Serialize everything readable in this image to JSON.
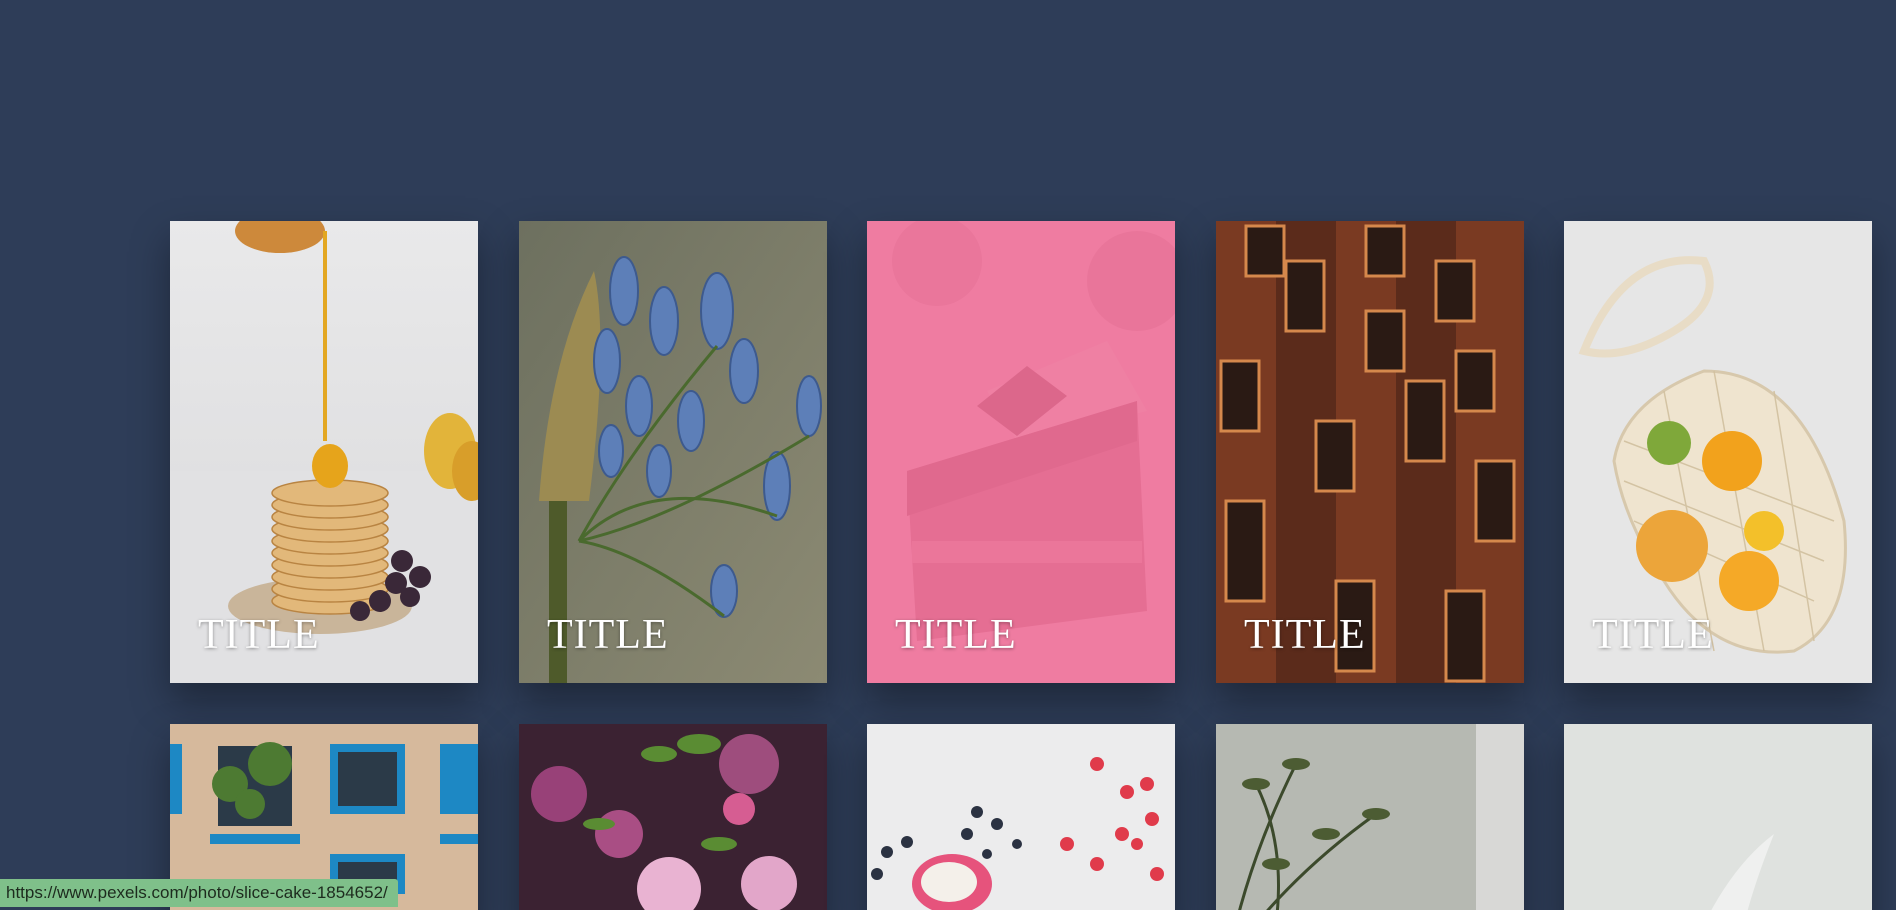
{
  "cards": [
    {
      "title": "TITLE",
      "image": "pancakes-honey"
    },
    {
      "title": "TITLE",
      "image": "blue-agapanthus-flower"
    },
    {
      "title": "TITLE",
      "image": "slice-cake",
      "overlay_color": "#ee6f98"
    },
    {
      "title": "TITLE",
      "image": "wooden-building-facade"
    },
    {
      "title": "TITLE",
      "image": "mesh-bag-oranges"
    }
  ],
  "cards_row2": [
    {
      "image": "apartment-balconies"
    },
    {
      "image": "pink-roses"
    },
    {
      "image": "berries-dragonfruit"
    },
    {
      "image": "green-plant"
    },
    {
      "image": "white-surface-splash"
    }
  ],
  "status": {
    "url": "https://www.pexels.com/photo/slice-cake-1854652/"
  },
  "colors": {
    "background": "#2e3d58",
    "status_bar": "#7fc08a",
    "highlight_overlay": "#ee6f98"
  }
}
